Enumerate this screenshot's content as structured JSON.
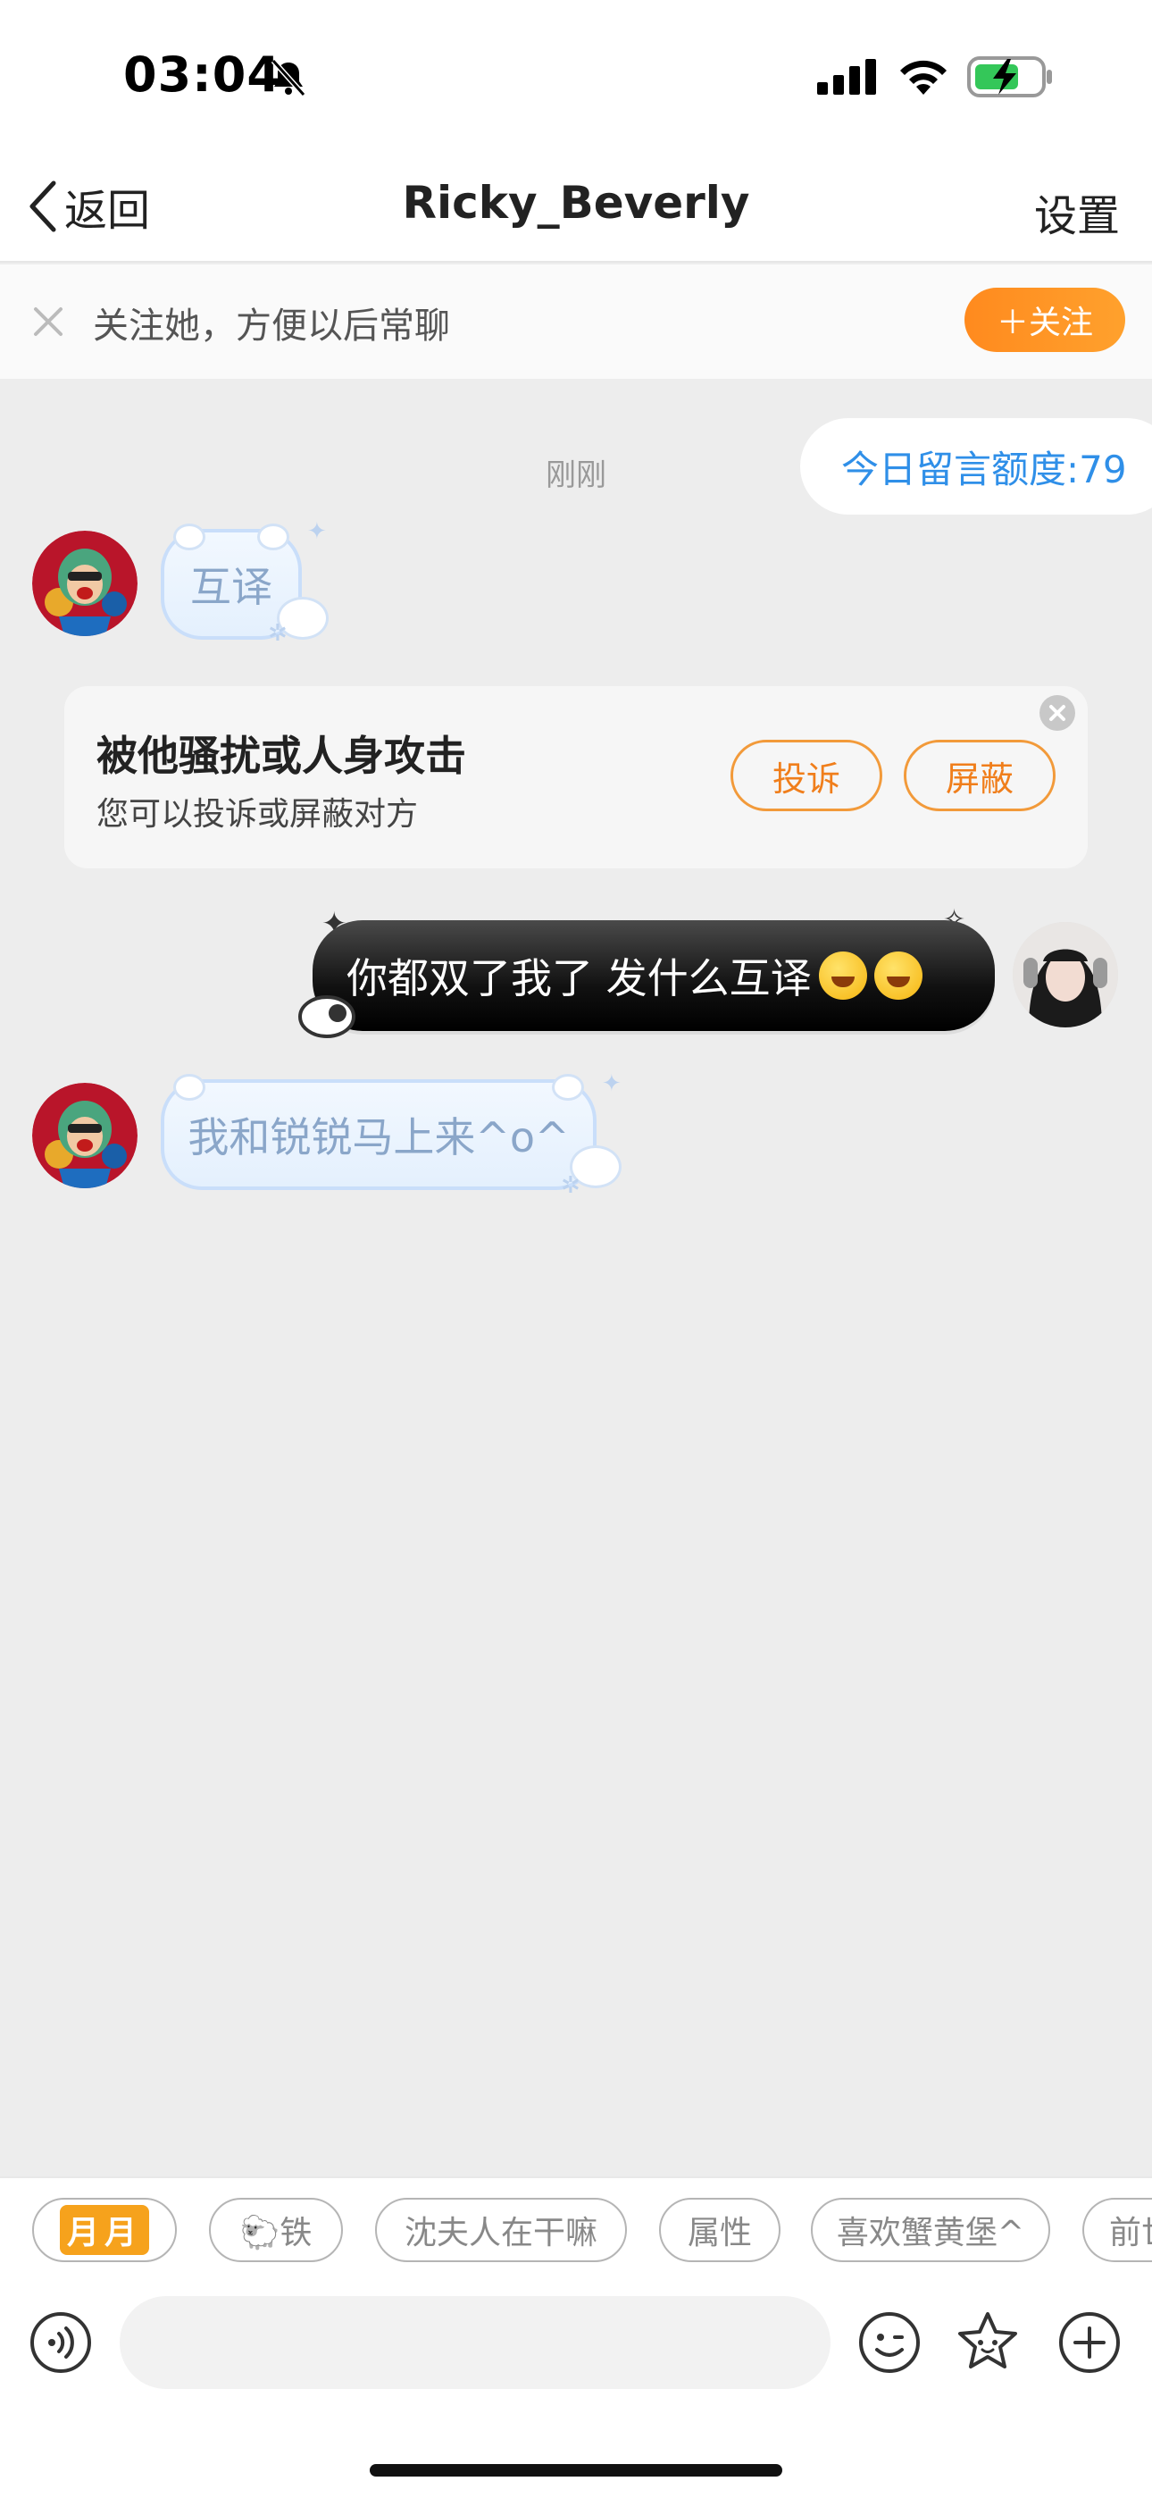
{
  "status": {
    "time": "03:04"
  },
  "nav": {
    "back_label": "返回",
    "title": "Ricky_Beverly",
    "settings_label": "设置"
  },
  "follow_bar": {
    "text": "关注她，方便以后常聊",
    "button_label": "＋关注"
  },
  "chat": {
    "timestamp": "刚刚",
    "quota": "今日留言额度:79",
    "messages": [
      {
        "side": "left",
        "text": "互译"
      },
      {
        "side": "right",
        "text": "你都双了我了 发什么互译"
      },
      {
        "side": "left",
        "text": "我和锐锐马上来^o^"
      }
    ]
  },
  "report_card": {
    "title": "被他骚扰或人身攻击",
    "subtitle": "您可以投诉或屏蔽对方",
    "complain_label": "投诉",
    "block_label": "屏蔽"
  },
  "quick_replies": [
    {
      "label": "月月"
    },
    {
      "label": "🐑铁"
    },
    {
      "label": "沈夫人在干嘛"
    },
    {
      "label": "属性"
    },
    {
      "label": "喜欢蟹黄堡^"
    },
    {
      "label": "前世"
    }
  ],
  "input": {
    "placeholder": ""
  },
  "colors": {
    "accent_orange": "#ff8a1e",
    "quota_blue": "#2f8fe8",
    "bg": "#ededed"
  }
}
